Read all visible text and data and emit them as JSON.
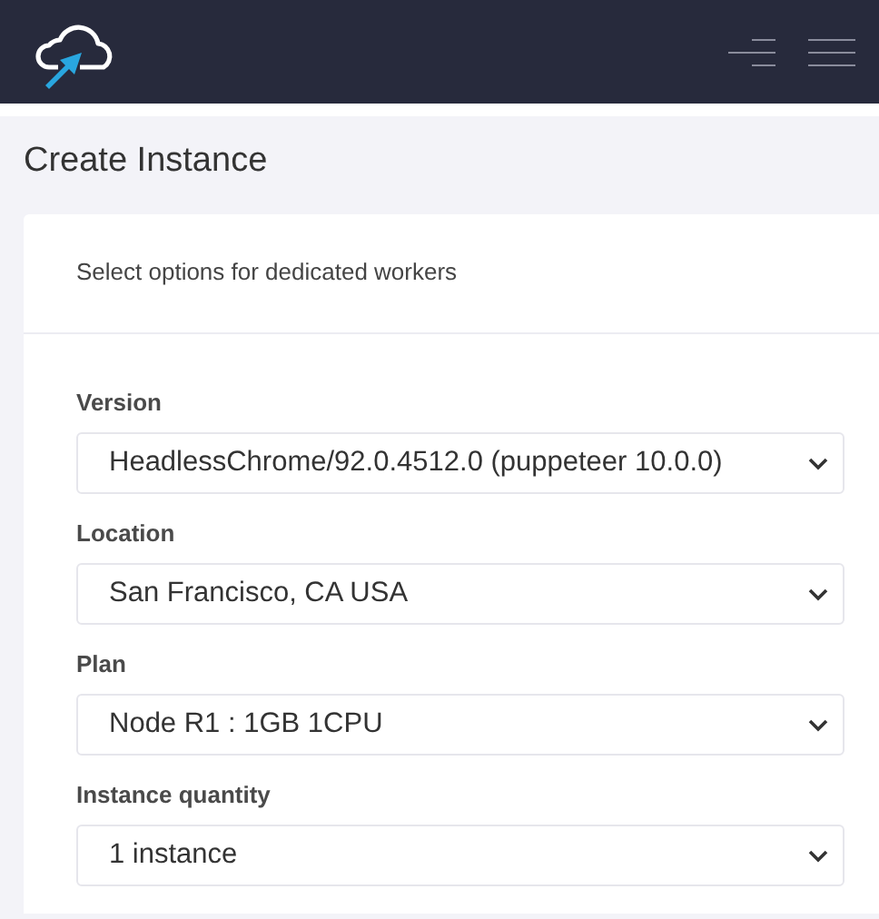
{
  "page": {
    "title": "Create Instance"
  },
  "card": {
    "subtitle": "Select options for dedicated workers",
    "fields": [
      {
        "label": "Version",
        "value": "HeadlessChrome/92.0.4512.0 (puppeteer 10.0.0)"
      },
      {
        "label": "Location",
        "value": "San Francisco, CA USA"
      },
      {
        "label": "Plan",
        "value": "Node R1 : 1GB 1CPU"
      },
      {
        "label": "Instance quantity",
        "value": "1 instance"
      }
    ]
  }
}
